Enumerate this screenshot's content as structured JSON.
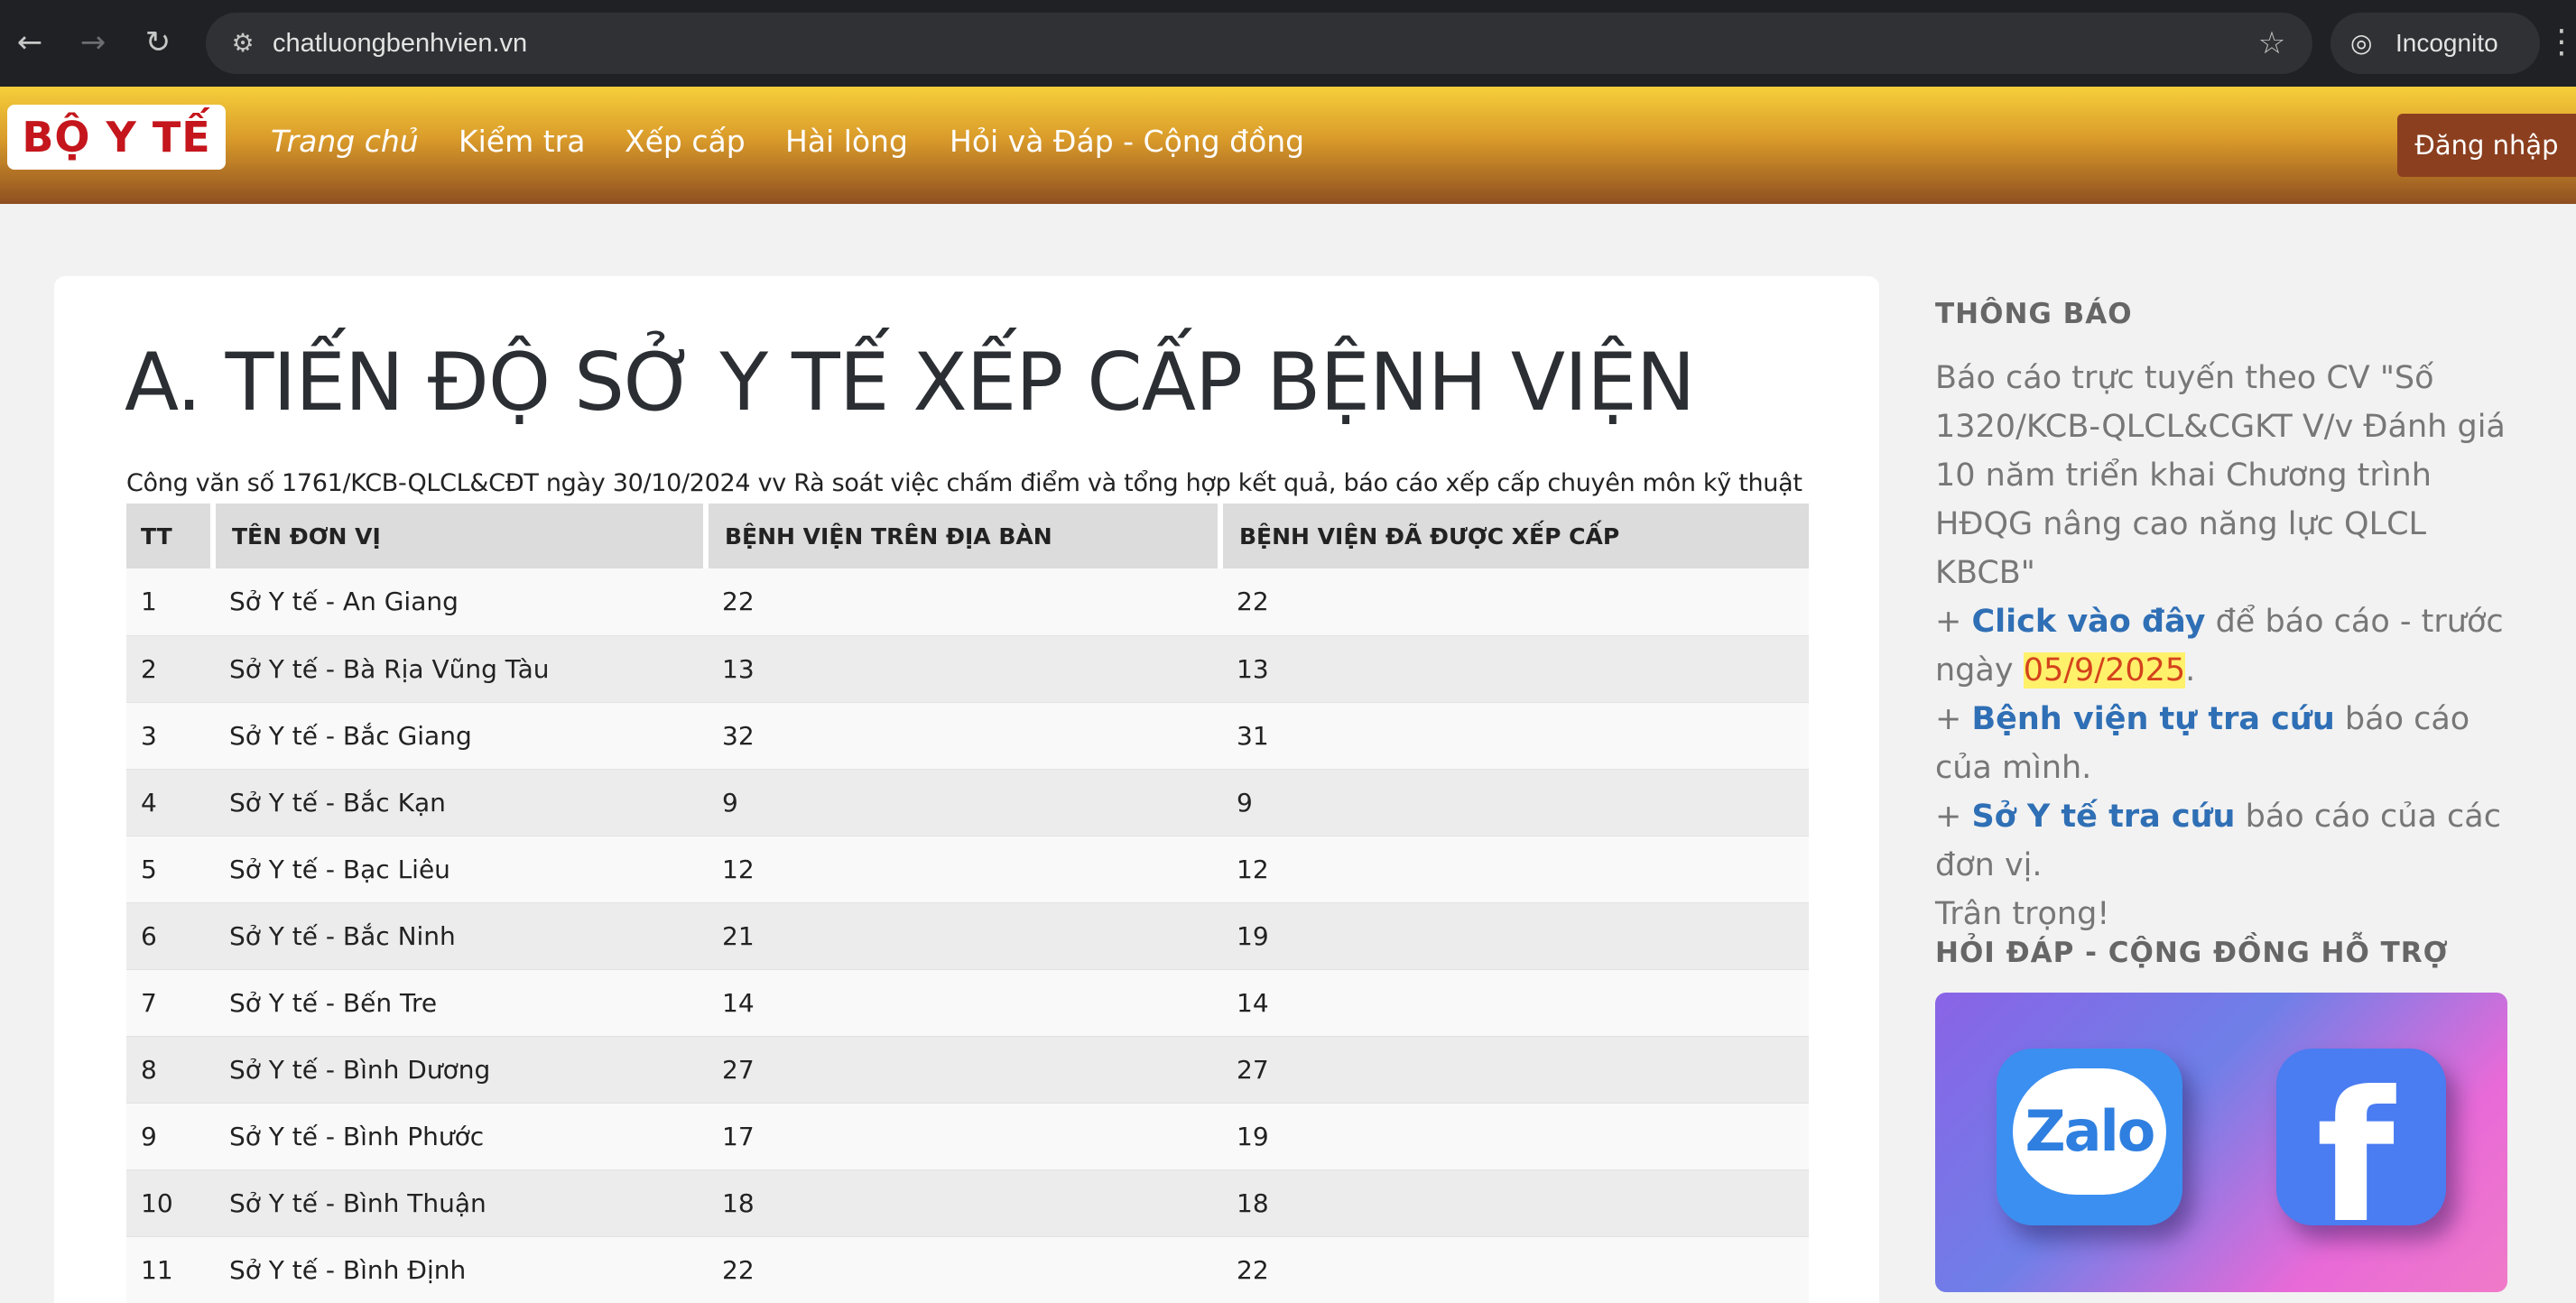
{
  "browser": {
    "url": "chatluongbenhvien.vn",
    "incognito_label": "Incognito"
  },
  "nav": {
    "logo_text": "BỘ Y TẾ",
    "items": [
      {
        "label": "Trang chủ"
      },
      {
        "label": "Kiểm tra"
      },
      {
        "label": "Xếp cấp"
      },
      {
        "label": "Hài lòng"
      },
      {
        "label": "Hỏi và Đáp - Cộng đồng"
      }
    ],
    "login_label": "Đăng nhập"
  },
  "main": {
    "title": "A. TIẾN ĐỘ SỞ Y TẾ XẾP CẤP BỆNH VIỆN",
    "subtitle": "Công văn số 1761/KCB-QLCL&CĐT ngày 30/10/2024 vv Rà soát việc chấm điểm và tổng hợp kết quả, báo cáo xếp cấp chuyên môn kỹ thuật",
    "table": {
      "headers": [
        "TT",
        "TÊN ĐƠN VỊ",
        "BỆNH VIỆN TRÊN ĐỊA BÀN",
        "BỆNH VIỆN ĐÃ ĐƯỢC XẾP CẤP"
      ],
      "rows": [
        [
          "1",
          "Sở Y tế - An Giang",
          "22",
          "22"
        ],
        [
          "2",
          "Sở Y tế - Bà Rịa Vũng Tàu",
          "13",
          "13"
        ],
        [
          "3",
          "Sở Y tế - Bắc Giang",
          "32",
          "31"
        ],
        [
          "4",
          "Sở Y tế - Bắc Kạn",
          "9",
          "9"
        ],
        [
          "5",
          "Sở Y tế - Bạc Liêu",
          "12",
          "12"
        ],
        [
          "6",
          "Sở Y tế - Bắc Ninh",
          "21",
          "19"
        ],
        [
          "7",
          "Sở Y tế - Bến Tre",
          "14",
          "14"
        ],
        [
          "8",
          "Sở Y tế - Bình Dương",
          "27",
          "27"
        ],
        [
          "9",
          "Sở Y tế - Bình Phước",
          "17",
          "19"
        ],
        [
          "10",
          "Sở Y tế - Bình Thuận",
          "18",
          "18"
        ],
        [
          "11",
          "Sở Y tế - Bình Định",
          "22",
          "22"
        ]
      ]
    }
  },
  "sidebar": {
    "notice_heading": "THÔNG BÁO",
    "notice_intro": "Báo cáo trực tuyến theo CV \"Số 1320/KCB-QLCL&CGKT V/v Đánh giá 10 năm triển khai Chương trình HĐQG nâng cao năng lực QLCL KBCB\"",
    "plus": "+",
    "link1": "Click vào đây",
    "link1_after": "để báo cáo - trước ngày",
    "deadline": "05/9/2025",
    "period": ".",
    "link2": "Bệnh viện tự tra cứu",
    "link2_after": "báo cáo của mình.",
    "link3": "Sở Y tế tra cứu",
    "link3_after": "báo cáo của các đơn vị.",
    "closing": "Trân trọng!",
    "community_heading": "HỎI ĐÁP - CỘNG ĐỒNG HỖ TRỢ",
    "zalo_label": "Zalo",
    "facebook_label": "f"
  }
}
